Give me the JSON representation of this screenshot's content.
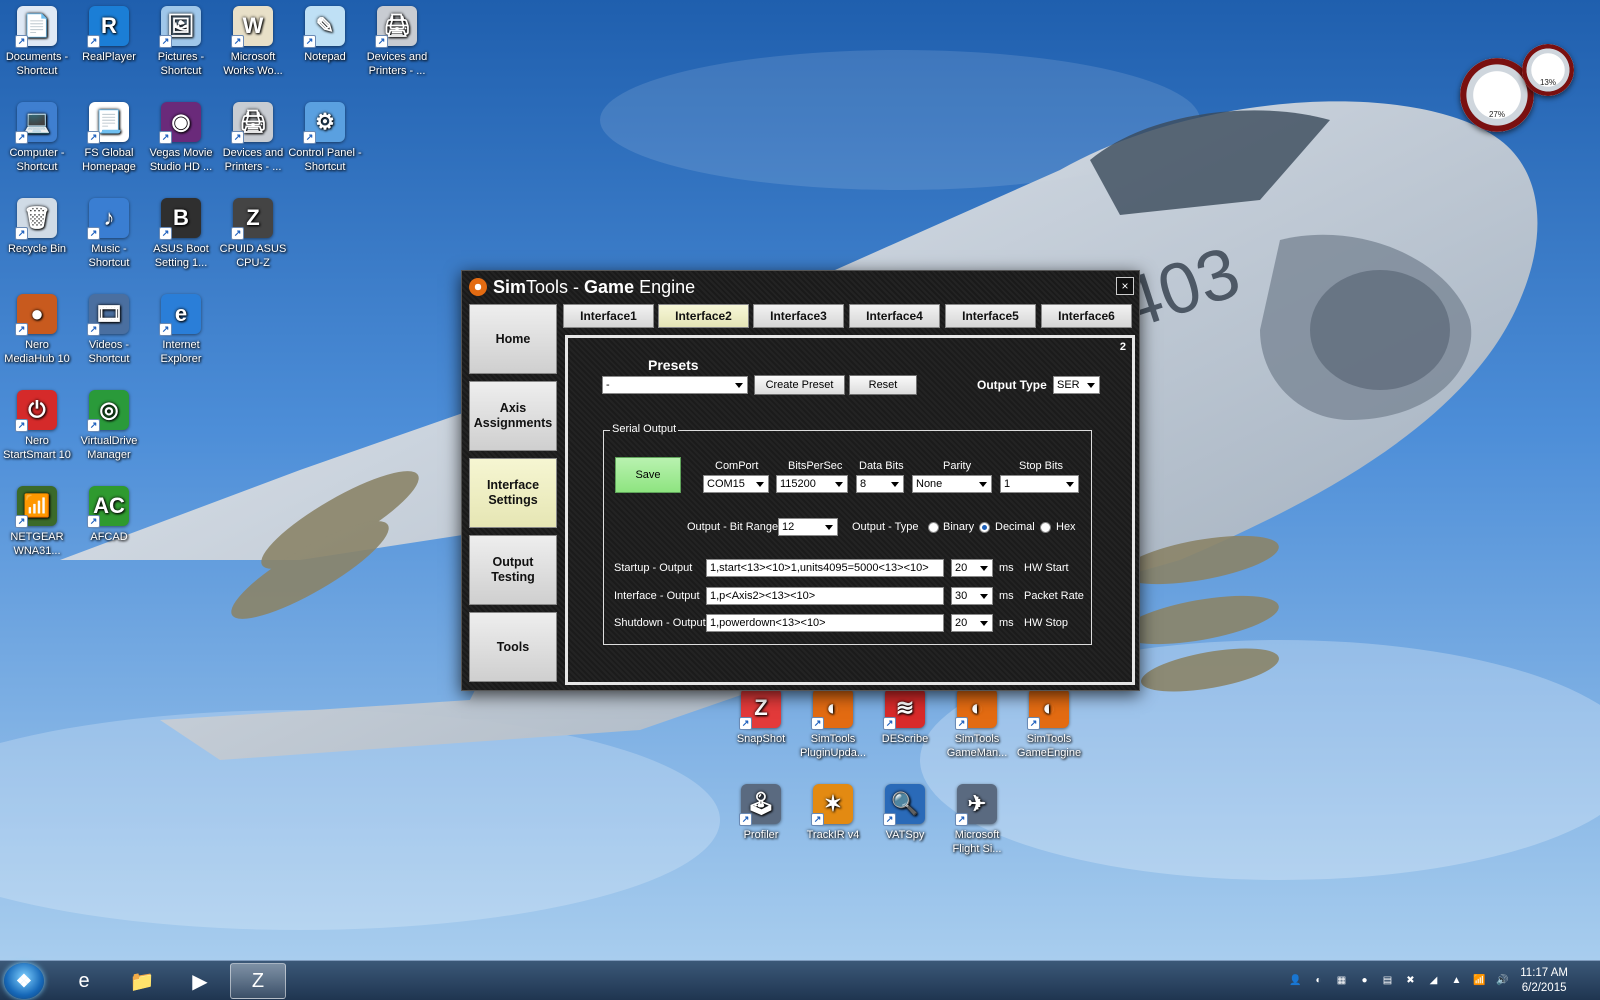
{
  "desktop": {
    "icons": [
      {
        "label": "Documents - Shortcut",
        "glyph": "📄",
        "color": "#dfe9f5"
      },
      {
        "label": "RealPlayer",
        "glyph": "R",
        "color": "#1b7ed6"
      },
      {
        "label": "Pictures - Shortcut",
        "glyph": "🖼",
        "color": "#9fc7ea"
      },
      {
        "label": "Microsoft Works Wo...",
        "glyph": "W",
        "color": "#e8e0c8"
      },
      {
        "label": "Notepad",
        "glyph": "✎",
        "color": "#bfe0f5"
      },
      {
        "label": "Devices and Printers - ...",
        "glyph": "🖨",
        "color": "#c8ccd2"
      },
      {
        "label": "Computer - Shortcut",
        "glyph": "💻",
        "color": "#3f7fd0"
      },
      {
        "label": "FS Global Homepage",
        "glyph": "📃",
        "color": "#ffffff"
      },
      {
        "label": "Vegas Movie Studio HD ...",
        "glyph": "◉",
        "color": "#6a2a7a"
      },
      {
        "label": "Devices and Printers - ...",
        "glyph": "🖨",
        "color": "#c8ccd2"
      },
      {
        "label": "Control Panel - Shortcut",
        "glyph": "⚙",
        "color": "#5aa0e0"
      },
      {
        "label": "Recycle Bin",
        "glyph": "🗑",
        "color": "#d0dbe6"
      },
      {
        "label": "Music - Shortcut",
        "glyph": "♪",
        "color": "#3a7ed2"
      },
      {
        "label": "ASUS Boot Setting 1...",
        "glyph": "B",
        "color": "#2f2f2f"
      },
      {
        "label": "CPUID ASUS CPU-Z",
        "glyph": "Z",
        "color": "#444444"
      },
      {
        "label": "Nero MediaHub 10",
        "glyph": "●",
        "color": "#c85a1e"
      },
      {
        "label": "Videos - Shortcut",
        "glyph": "🎞",
        "color": "#4a6fa0"
      },
      {
        "label": "Internet Explorer",
        "glyph": "e",
        "color": "#2a7ed8"
      },
      {
        "label": "Nero StartSmart 10",
        "glyph": "⏻",
        "color": "#d52a2a"
      },
      {
        "label": "VirtualDrive Manager",
        "glyph": "◎",
        "color": "#2a9a3a"
      },
      {
        "label": "NETGEAR WNA31...",
        "glyph": "📶",
        "color": "#3b6a2a"
      },
      {
        "label": "AFCAD",
        "glyph": "AC",
        "color": "#2f9a2f"
      }
    ],
    "bottom_icons": [
      {
        "label": "SnapShot",
        "glyph": "Z",
        "color": "#e33a3a"
      },
      {
        "label": "SimTools PluginUpda...",
        "glyph": "◐",
        "color": "#e36b12"
      },
      {
        "label": "DEScribe",
        "glyph": "≋",
        "color": "#d82a2a"
      },
      {
        "label": "SimTools GameMan...",
        "glyph": "◐",
        "color": "#e36b12"
      },
      {
        "label": "SimTools GameEngine",
        "glyph": "◐",
        "color": "#e36b12"
      },
      {
        "label": "Profiler",
        "glyph": "🕹",
        "color": "#5a6a80"
      },
      {
        "label": "TrackIR v4",
        "glyph": "✶",
        "color": "#e38a12"
      },
      {
        "label": "VATSpy",
        "glyph": "🔍",
        "color": "#2a6ab8"
      },
      {
        "label": "Microsoft Flight Si...",
        "glyph": "✈",
        "color": "#5a6a80"
      }
    ],
    "gauges": [
      {
        "label": "27%"
      },
      {
        "label": "13%"
      }
    ],
    "jet_tail_number": "403"
  },
  "window": {
    "title_brand": "Sim",
    "title_brand2": "Tools - ",
    "title_bold": "Game",
    "title_rest": " Engine",
    "close_label": "×",
    "nav": [
      {
        "label": "Home",
        "active": false
      },
      {
        "label": "Axis Assignments",
        "active": false
      },
      {
        "label": "Interface Settings",
        "active": true
      },
      {
        "label": "Output Testing",
        "active": false
      },
      {
        "label": "Tools",
        "active": false
      }
    ],
    "tabs": [
      {
        "label": "Interface1",
        "active": false
      },
      {
        "label": "Interface2",
        "active": true
      },
      {
        "label": "Interface3",
        "active": false
      },
      {
        "label": "Interface4",
        "active": false
      },
      {
        "label": "Interface5",
        "active": false
      },
      {
        "label": "Interface6",
        "active": false
      }
    ],
    "panel": {
      "number": "2",
      "presets_label": "Presets",
      "preset_value": "-",
      "create_preset_label": "Create Preset",
      "reset_label": "Reset",
      "output_type_label": "Output Type",
      "output_type_value": "SER",
      "serial_group_label": "Serial Output",
      "save_label": "Save",
      "comport_label": "ComPort",
      "comport_value": "COM15",
      "bps_label": "BitsPerSec",
      "bps_value": "115200",
      "databits_label": "Data Bits",
      "databits_value": "8",
      "parity_label": "Parity",
      "parity_value": "None",
      "stopbits_label": "Stop Bits",
      "stopbits_value": "1",
      "bitrange_label": "Output - Bit Range",
      "bitrange_value": "12",
      "outtype_label": "Output - Type",
      "radio_binary": "Binary",
      "radio_decimal": "Decimal",
      "radio_hex": "Hex",
      "selected_output_type": "Decimal",
      "startup_label": "Startup - Output",
      "startup_value": "1,start<13><10>1,units4095=5000<13><10>",
      "startup_ms": "20",
      "startup_hint": "HW Start",
      "interface_label": "Interface - Output",
      "interface_value": "1,p<Axis2><13><10>",
      "interface_ms": "30",
      "interface_hint": "Packet Rate",
      "shutdown_label": "Shutdown - Output",
      "shutdown_value": "1,powerdown<13><10>",
      "shutdown_ms": "20",
      "shutdown_hint": "HW Stop",
      "ms_unit": "ms"
    }
  },
  "taskbar": {
    "start_glyph": "❖",
    "buttons": [
      {
        "name": "internet-explorer",
        "glyph": "e",
        "active": false
      },
      {
        "name": "file-explorer",
        "glyph": "📁",
        "active": false
      },
      {
        "name": "media-player",
        "glyph": "▶",
        "active": false
      },
      {
        "name": "snapshot",
        "glyph": "Z",
        "active": true
      }
    ],
    "tray": [
      "👤",
      "◐",
      "▦",
      "●",
      "▤",
      "✖",
      "◢",
      "▲",
      "📶",
      "🔊"
    ],
    "time": "11:17 AM",
    "date": "6/2/2015"
  }
}
